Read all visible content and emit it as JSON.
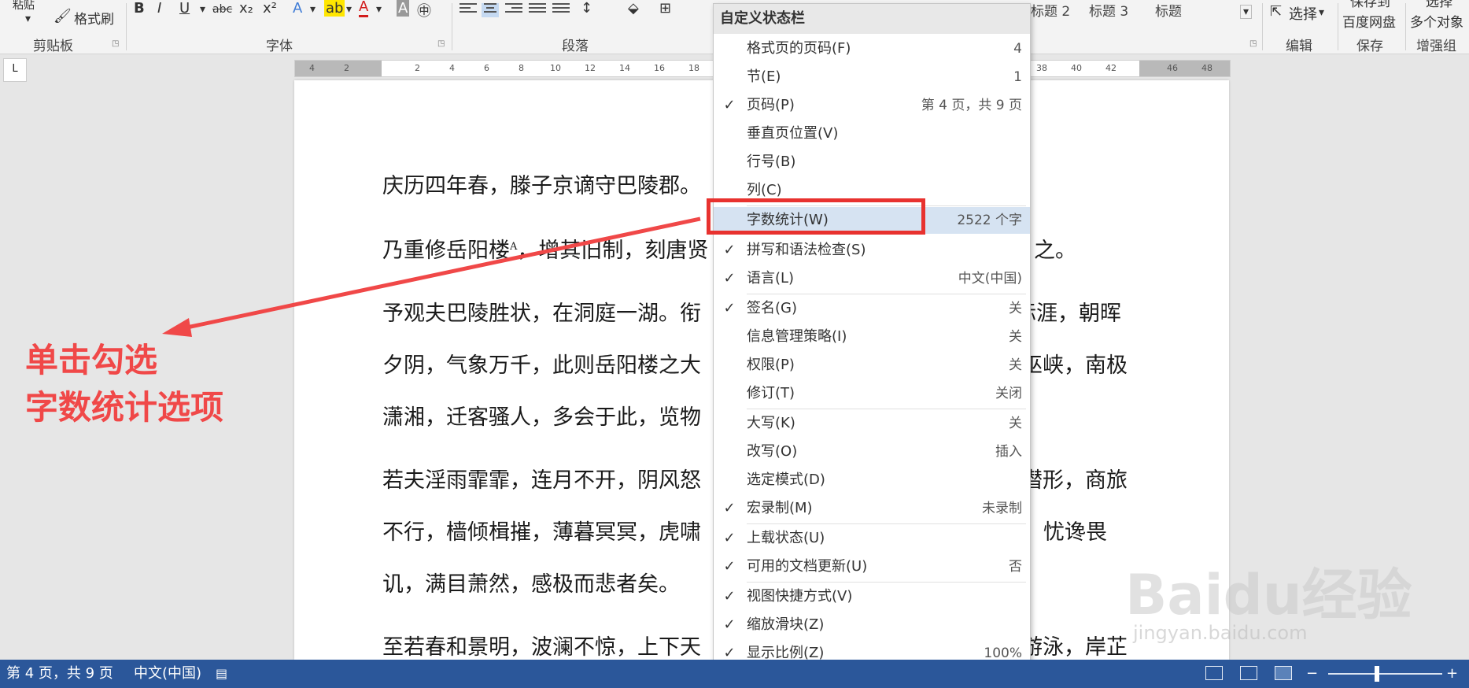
{
  "ribbon": {
    "clipboard": {
      "paste_label": "粘贴",
      "format_painter_label": "格式刷",
      "group_label": "剪贴板"
    },
    "font": {
      "bold": "B",
      "italic": "I",
      "underline": "U",
      "strikethrough": "abc",
      "subscript": "x₂",
      "superscript": "x²",
      "text_effects": "A",
      "highlight": "ab",
      "font_color": "A",
      "char_shading": "A",
      "enclose": "㊥",
      "group_label": "字体"
    },
    "paragraph": {
      "group_label": "段落"
    },
    "styles": {
      "items": [
        "标题 2",
        "标题 3",
        "标题"
      ]
    },
    "editing": {
      "select_label": "选择",
      "group_label": "编辑"
    },
    "save": {
      "label_line1": "保存到",
      "label_line2": "百度网盘",
      "group_label": "保存"
    },
    "enhance": {
      "label_line1": "选择",
      "label_line2": "多个对象",
      "group_label": "增强组"
    }
  },
  "ruler": {
    "corner": "L",
    "ticks": [
      "4",
      "2",
      "2",
      "4",
      "6",
      "8",
      "10",
      "12",
      "14",
      "16",
      "18",
      "38",
      "40",
      "42",
      "46",
      "48"
    ]
  },
  "document": {
    "lines": [
      "庆历四年春，滕子京谪守巴陵郡。",
      "乃重修岳阳楼",
      "，增其旧制，刻唐贤",
      "予观夫巴陵胜状，在洞庭一湖。衔",
      "夕阴，气象万千，此则岳阳楼之大",
      "潇湘，迁客骚人，多会于此，览物",
      "若夫淫雨霏霏，连月不开，阴风怒",
      "不行，樯倾楫摧，薄暮冥冥，虎啸",
      "讥，满目萧然，感极而悲者矣。",
      "至若春和景明，波澜不惊，上下天"
    ],
    "superscript_mark": "A",
    "right_fragments": [
      "之。",
      "际涯，朝晖",
      "巫峡，南极",
      "潜形，商旅",
      "忧谗畏",
      "游泳，岸芷"
    ]
  },
  "annotation": {
    "line1": "单击勾选",
    "line2": "字数统计选项"
  },
  "context_menu": {
    "title": "自定义状态栏",
    "items": [
      {
        "label": "格式页的页码(F)",
        "value": "4",
        "checked": false
      },
      {
        "label": "节(E)",
        "value": "1",
        "checked": false
      },
      {
        "label": "页码(P)",
        "value": "第 4 页，共 9 页",
        "checked": true
      },
      {
        "label": "垂直页位置(V)",
        "value": "",
        "checked": false
      },
      {
        "label": "行号(B)",
        "value": "",
        "checked": false
      },
      {
        "label": "列(C)",
        "value": "",
        "checked": false
      },
      {
        "label": "字数统计(W)",
        "value": "2522 个字",
        "checked": false
      },
      {
        "label": "拼写和语法检查(S)",
        "value": "",
        "checked": true
      },
      {
        "label": "语言(L)",
        "value": "中文(中国)",
        "checked": true
      },
      {
        "label": "签名(G)",
        "value": "关",
        "checked": true
      },
      {
        "label": "信息管理策略(I)",
        "value": "关",
        "checked": false
      },
      {
        "label": "权限(P)",
        "value": "关",
        "checked": false
      },
      {
        "label": "修订(T)",
        "value": "关闭",
        "checked": false
      },
      {
        "label": "大写(K)",
        "value": "关",
        "checked": false
      },
      {
        "label": "改写(O)",
        "value": "插入",
        "checked": false
      },
      {
        "label": "选定模式(D)",
        "value": "",
        "checked": false
      },
      {
        "label": "宏录制(M)",
        "value": "未录制",
        "checked": true
      },
      {
        "label": "上载状态(U)",
        "value": "",
        "checked": true
      },
      {
        "label": "可用的文档更新(U)",
        "value": "否",
        "checked": true
      },
      {
        "label": "视图快捷方式(V)",
        "value": "",
        "checked": true
      },
      {
        "label": "缩放滑块(Z)",
        "value": "",
        "checked": true
      },
      {
        "label": "显示比例(Z)",
        "value": "100%",
        "checked": true
      }
    ],
    "check_glyph": "✓"
  },
  "status_bar": {
    "page": "第 4 页，共 9 页",
    "language": "中文(中国)",
    "zoom_minus": "−",
    "zoom_plus": "+",
    "zoom_level_fraction": 0.43,
    "bg_color": "#2b579a"
  },
  "watermark": {
    "text": "Baidu经验",
    "url_text": "jingyan.baidu.com"
  }
}
